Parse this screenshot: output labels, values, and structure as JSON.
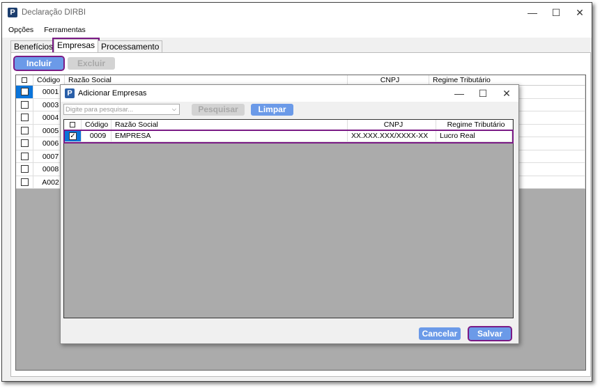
{
  "window": {
    "title": "Declaração DIRBI",
    "logo": "P"
  },
  "menu": [
    "Opções",
    "Ferramentas"
  ],
  "tabs": [
    "Benefícios",
    "Empresas",
    "Processamento"
  ],
  "toolbar": {
    "include": "Incluir",
    "exclude": "Excluir"
  },
  "main_grid": {
    "columns": [
      "Código",
      "Razão Social",
      "CNPJ",
      "Regime Tributário"
    ],
    "rows": [
      "0001",
      "0003",
      "0004",
      "0005",
      "0006",
      "0007",
      "0008",
      "A002"
    ]
  },
  "dialog": {
    "title": "Adicionar Empresas",
    "search_placeholder": "Digite para pesquisar...",
    "search": "Pesquisar",
    "clear": "Limpar",
    "columns": [
      "Código",
      "Razão Social",
      "CNPJ",
      "Regime Tributário"
    ],
    "rows": [
      {
        "codigo": "0009",
        "razao": "EMPRESA",
        "cnpj": "XX.XXX.XXX/XXXX-XX",
        "regime": "Lucro Real",
        "checked": true
      }
    ],
    "cancel": "Cancelar",
    "save": "Salvar"
  },
  "colors": {
    "accent": "#6b9ae8",
    "highlight": "#7a1a85"
  }
}
